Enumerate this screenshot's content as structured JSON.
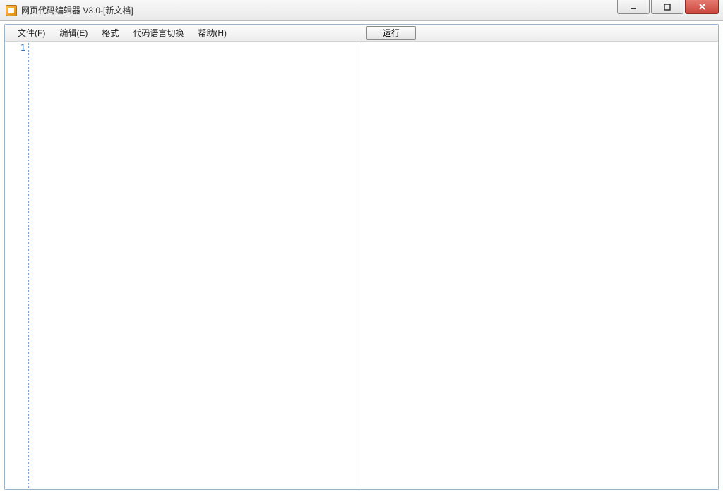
{
  "titlebar": {
    "title": "网页代码编辑器 V3.0-[新文档]"
  },
  "menubar": {
    "items": [
      {
        "label": "文件(F)"
      },
      {
        "label": "编辑(E)"
      },
      {
        "label": "格式"
      },
      {
        "label": "代码语言切换"
      },
      {
        "label": "帮助(H)"
      }
    ],
    "run_label": "运行"
  },
  "editor": {
    "line_numbers": [
      "1"
    ],
    "content": ""
  }
}
